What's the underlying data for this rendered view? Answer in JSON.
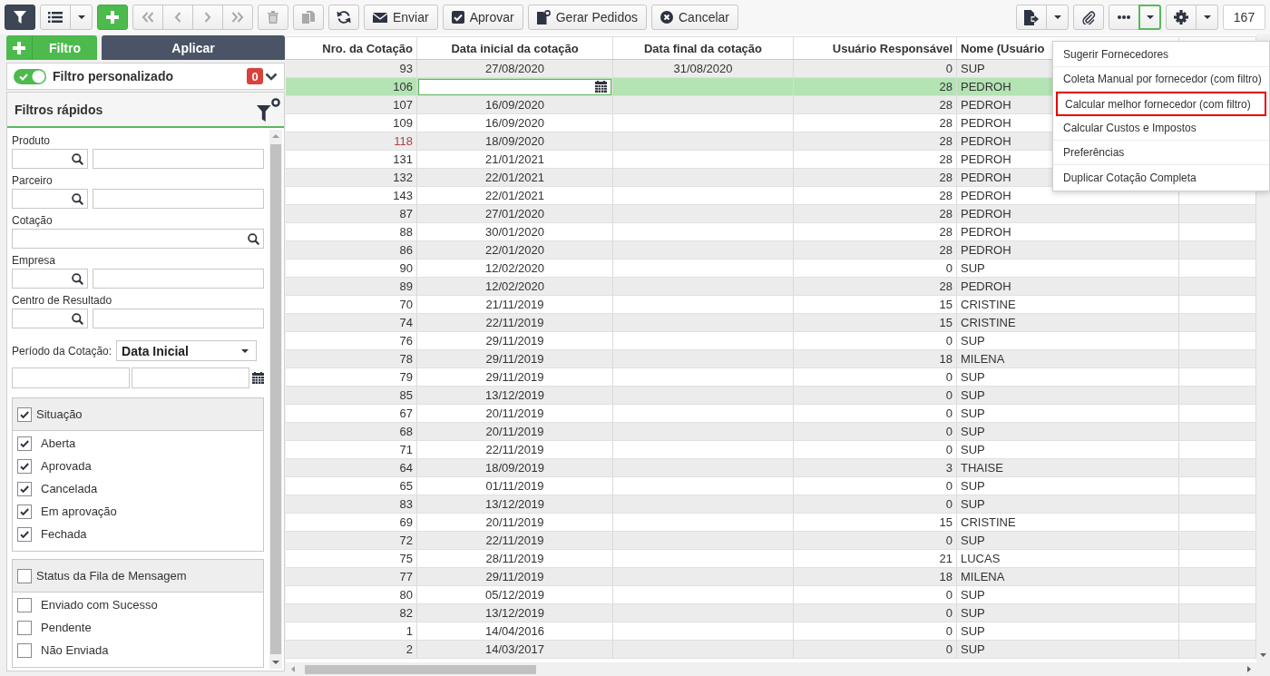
{
  "toolbar": {
    "left": [
      {
        "buttons": [
          {
            "kind": "filter",
            "on": true,
            "disabled": false
          }
        ]
      },
      {
        "buttons": [
          {
            "kind": "list",
            "disabled": false
          },
          {
            "kind": "dropdown",
            "disabled": false,
            "open": false
          }
        ]
      },
      {
        "buttons": [
          {
            "kind": "add",
            "disabled": false
          }
        ]
      },
      {
        "buttons": [
          {
            "kind": "first",
            "disabled": true
          },
          {
            "kind": "previous",
            "disabled": true
          },
          {
            "kind": "next",
            "disabled": true
          },
          {
            "kind": "last",
            "disabled": true
          }
        ]
      },
      {
        "buttons": [
          {
            "kind": "delete",
            "disabled": true
          }
        ]
      },
      {
        "buttons": [
          {
            "kind": "copy",
            "disabled": true
          }
        ]
      },
      {
        "buttons": [
          {
            "kind": "refresh",
            "disabled": false
          }
        ]
      },
      {
        "buttons": [
          {
            "kind": "send",
            "label": "Enviar",
            "disabled": false
          }
        ]
      },
      {
        "buttons": [
          {
            "kind": "approve",
            "label": "Aprovar",
            "disabled": false
          }
        ]
      },
      {
        "buttons": [
          {
            "kind": "orders",
            "label": "Gerar Pedidos",
            "disabled": false
          }
        ]
      },
      {
        "buttons": [
          {
            "kind": "cancel",
            "label": "Cancelar",
            "disabled": false
          }
        ]
      }
    ],
    "right": [
      {
        "buttons": [
          {
            "kind": "export",
            "disabled": false
          },
          {
            "kind": "dropdown",
            "disabled": false,
            "open": false
          }
        ]
      },
      {
        "buttons": [
          {
            "kind": "attach",
            "disabled": false
          }
        ]
      },
      {
        "buttons": [
          {
            "kind": "more",
            "disabled": false
          },
          {
            "kind": "dropdown",
            "disabled": false,
            "open": true
          }
        ]
      },
      {
        "buttons": [
          {
            "kind": "settings",
            "disabled": false
          },
          {
            "kind": "dropdown",
            "disabled": false,
            "open": false
          }
        ]
      }
    ],
    "record_count": "167"
  },
  "filter_panel": {
    "add_filter_button": {
      "label": "Filtro"
    },
    "apply_button": {
      "label": "Aplicar"
    },
    "custom_filter": {
      "on": true,
      "label": "Filtro personalizado",
      "count": "0"
    },
    "quick_filters": {
      "title": "Filtros rápidos",
      "fields": [
        {
          "kind": "lookup",
          "label": "Produto"
        },
        {
          "kind": "lookup",
          "label": "Parceiro"
        },
        {
          "kind": "search",
          "label": "Cotação"
        },
        {
          "kind": "lookup",
          "label": "Empresa"
        },
        {
          "kind": "lookup",
          "label": "Centro de Resultado"
        }
      ],
      "period": {
        "label": "Período da Cotação:",
        "value": "Data Inicial"
      },
      "groups": [
        {
          "title": "Situação",
          "checked": true,
          "options": [
            {
              "label": "Aberta",
              "checked": true
            },
            {
              "label": "Aprovada",
              "checked": true
            },
            {
              "label": "Cancelada",
              "checked": true
            },
            {
              "label": "Em aprovação",
              "checked": true
            },
            {
              "label": "Fechada",
              "checked": true
            }
          ]
        },
        {
          "title": "Status da Fila de Mensagem",
          "checked": false,
          "options": [
            {
              "label": "Enviado com Sucesso",
              "checked": false
            },
            {
              "label": "Pendente",
              "checked": false
            },
            {
              "label": "Não Enviada",
              "checked": false
            }
          ]
        }
      ]
    }
  },
  "table": {
    "columns": [
      "Nro. da Cotação",
      "Data inicial da cotação",
      "Data final da cotação",
      "Usuário Responsável",
      "Nome (Usuário"
    ],
    "rows": [
      {
        "number": "93",
        "color": "#333333",
        "start": "27/08/2020",
        "end": "31/08/2020",
        "user_id": "0",
        "user_name": "SUP",
        "selected": false,
        "editing": false
      },
      {
        "number": "106",
        "color": "#333333",
        "user_id": "28",
        "user_name": "PEDROH",
        "selected": true,
        "editing": true
      },
      {
        "number": "107",
        "color": "#333333",
        "start": "16/09/2020",
        "user_id": "28",
        "user_name": "PEDROH",
        "selected": false,
        "editing": false
      },
      {
        "number": "109",
        "color": "#333333",
        "start": "16/09/2020",
        "user_id": "28",
        "user_name": "PEDROH",
        "selected": false,
        "editing": false
      },
      {
        "number": "118",
        "color": "#a94442",
        "start": "18/09/2020",
        "user_id": "28",
        "user_name": "PEDROH",
        "selected": false,
        "editing": false
      },
      {
        "number": "131",
        "color": "#333333",
        "start": "21/01/2021",
        "user_id": "28",
        "user_name": "PEDROH",
        "selected": false,
        "editing": false
      },
      {
        "number": "132",
        "color": "#333333",
        "start": "22/01/2021",
        "user_id": "28",
        "user_name": "PEDROH",
        "selected": false,
        "editing": false
      },
      {
        "number": "143",
        "color": "#333333",
        "start": "22/01/2021",
        "user_id": "28",
        "user_name": "PEDROH",
        "selected": false,
        "editing": false
      },
      {
        "number": "87",
        "color": "#333333",
        "start": "27/01/2020",
        "user_id": "28",
        "user_name": "PEDROH",
        "selected": false,
        "editing": false
      },
      {
        "number": "88",
        "color": "#333333",
        "start": "30/01/2020",
        "user_id": "28",
        "user_name": "PEDROH",
        "selected": false,
        "editing": false
      },
      {
        "number": "86",
        "color": "#333333",
        "start": "22/01/2020",
        "user_id": "28",
        "user_name": "PEDROH",
        "selected": false,
        "editing": false
      },
      {
        "number": "90",
        "color": "#333333",
        "start": "12/02/2020",
        "user_id": "0",
        "user_name": "SUP",
        "selected": false,
        "editing": false
      },
      {
        "number": "89",
        "color": "#333333",
        "start": "12/02/2020",
        "user_id": "28",
        "user_name": "PEDROH",
        "selected": false,
        "editing": false
      },
      {
        "number": "70",
        "color": "#333333",
        "start": "21/11/2019",
        "user_id": "15",
        "user_name": "CRISTINE",
        "selected": false,
        "editing": false
      },
      {
        "number": "74",
        "color": "#333333",
        "start": "22/11/2019",
        "user_id": "15",
        "user_name": "CRISTINE",
        "selected": false,
        "editing": false
      },
      {
        "number": "76",
        "color": "#333333",
        "start": "29/11/2019",
        "user_id": "0",
        "user_name": "SUP",
        "selected": false,
        "editing": false
      },
      {
        "number": "78",
        "color": "#333333",
        "start": "29/11/2019",
        "user_id": "18",
        "user_name": "MILENA",
        "selected": false,
        "editing": false
      },
      {
        "number": "79",
        "color": "#333333",
        "start": "29/11/2019",
        "user_id": "0",
        "user_name": "SUP",
        "selected": false,
        "editing": false
      },
      {
        "number": "85",
        "color": "#333333",
        "start": "13/12/2019",
        "user_id": "0",
        "user_name": "SUP",
        "selected": false,
        "editing": false
      },
      {
        "number": "67",
        "color": "#333333",
        "start": "20/11/2019",
        "user_id": "0",
        "user_name": "SUP",
        "selected": false,
        "editing": false
      },
      {
        "number": "68",
        "color": "#333333",
        "start": "20/11/2019",
        "user_id": "0",
        "user_name": "SUP",
        "selected": false,
        "editing": false
      },
      {
        "number": "71",
        "color": "#333333",
        "start": "22/11/2019",
        "user_id": "0",
        "user_name": "SUP",
        "selected": false,
        "editing": false
      },
      {
        "number": "64",
        "color": "#333333",
        "start": "18/09/2019",
        "user_id": "3",
        "user_name": "THAISE",
        "selected": false,
        "editing": false
      },
      {
        "number": "65",
        "color": "#333333",
        "start": "01/11/2019",
        "user_id": "0",
        "user_name": "SUP",
        "selected": false,
        "editing": false
      },
      {
        "number": "83",
        "color": "#333333",
        "start": "13/12/2019",
        "user_id": "0",
        "user_name": "SUP",
        "selected": false,
        "editing": false
      },
      {
        "number": "69",
        "color": "#333333",
        "start": "20/11/2019",
        "user_id": "15",
        "user_name": "CRISTINE",
        "selected": false,
        "editing": false
      },
      {
        "number": "72",
        "color": "#333333",
        "start": "22/11/2019",
        "user_id": "0",
        "user_name": "SUP",
        "selected": false,
        "editing": false
      },
      {
        "number": "75",
        "color": "#333333",
        "start": "28/11/2019",
        "user_id": "21",
        "user_name": "LUCAS",
        "selected": false,
        "editing": false
      },
      {
        "number": "77",
        "color": "#333333",
        "start": "29/11/2019",
        "user_id": "18",
        "user_name": "MILENA",
        "selected": false,
        "editing": false
      },
      {
        "number": "80",
        "color": "#333333",
        "start": "05/12/2019",
        "user_id": "0",
        "user_name": "SUP",
        "selected": false,
        "editing": false
      },
      {
        "number": "82",
        "color": "#333333",
        "start": "13/12/2019",
        "user_id": "0",
        "user_name": "SUP",
        "selected": false,
        "editing": false
      },
      {
        "number": "1",
        "color": "#333333",
        "start": "14/04/2016",
        "user_id": "0",
        "user_name": "SUP",
        "selected": false,
        "editing": false
      },
      {
        "number": "2",
        "color": "#333333",
        "start": "14/03/2017",
        "user_id": "0",
        "user_name": "SUP",
        "selected": false,
        "editing": false
      }
    ]
  },
  "dropdown_menu": {
    "items": [
      {
        "label": "Sugerir Fornecedores",
        "highlighted": false
      },
      {
        "label": "Coleta Manual por fornecedor (com filtro)",
        "highlighted": false
      },
      {
        "label": "Calcular melhor fornecedor (com filtro)",
        "highlighted": true
      },
      {
        "label": "Calcular Custos e Impostos",
        "highlighted": false
      },
      {
        "label": "Preferências",
        "highlighted": false
      },
      {
        "label": "Duplicar Cotação Completa",
        "highlighted": false
      }
    ]
  }
}
